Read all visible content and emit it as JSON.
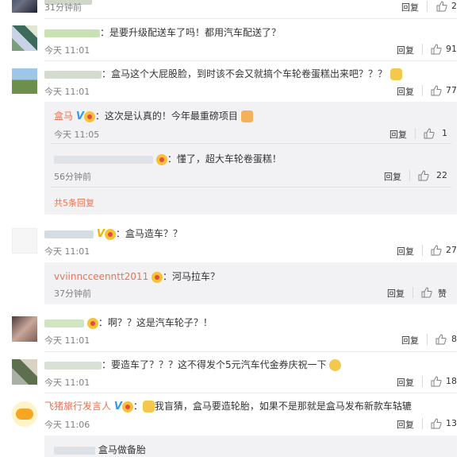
{
  "comments": [
    {
      "time": "31分钟前",
      "reply": "回复",
      "likes": "2"
    },
    {
      "text": "：是要升级配送车了吗！都用汽车配送了？",
      "time": "今天 11:01",
      "reply": "回复",
      "likes": "91"
    },
    {
      "text": "：盒马这个大屁股脸，到时该不会又就搞个车轮卷蛋糕出来吧？？？",
      "time": "今天 11:01",
      "reply": "回复",
      "likes": "77"
    },
    {
      "text": "：盒马造车？？",
      "time": "今天 11:01",
      "reply": "回复",
      "likes": "27"
    },
    {
      "text": "：啊？？这是汽车轮子？！",
      "time": "今天 11:01",
      "reply": "回复",
      "likes": "8"
    },
    {
      "text": "：要造车了？？？这不得发个5元汽车代金券庆祝一下",
      "time": "今天 11:01",
      "reply": "回复",
      "likes": "18"
    },
    {
      "name": "飞猪旅行发言人",
      "text": "我盲猜，盒马要造轮胎，如果不是那就是盒马发布新款车轱辘",
      "time": "今天 11:06",
      "reply": "回复",
      "likes": "13"
    }
  ],
  "subreplies": [
    {
      "name": "盒马",
      "text": "：这次是认真的！今年最重磅项目",
      "time": "今天 11:05",
      "reply": "回复",
      "likes": "1"
    },
    {
      "text": "：懂了，超大车轮卷蛋糕！",
      "time": "56分钟前",
      "reply": "回复",
      "likes": "22"
    },
    {
      "more": "共5条回复"
    },
    {
      "name": "vviinncceenntt2011",
      "text": "：河马拉车？",
      "time": "37分钟前",
      "reply": "回复",
      "likes": "赞"
    },
    {
      "text": "盒马做备胎"
    }
  ],
  "colors": {
    "accent": "#eb7350",
    "vblue": "#2e9bf1",
    "subbg": "#f2f2f5"
  }
}
